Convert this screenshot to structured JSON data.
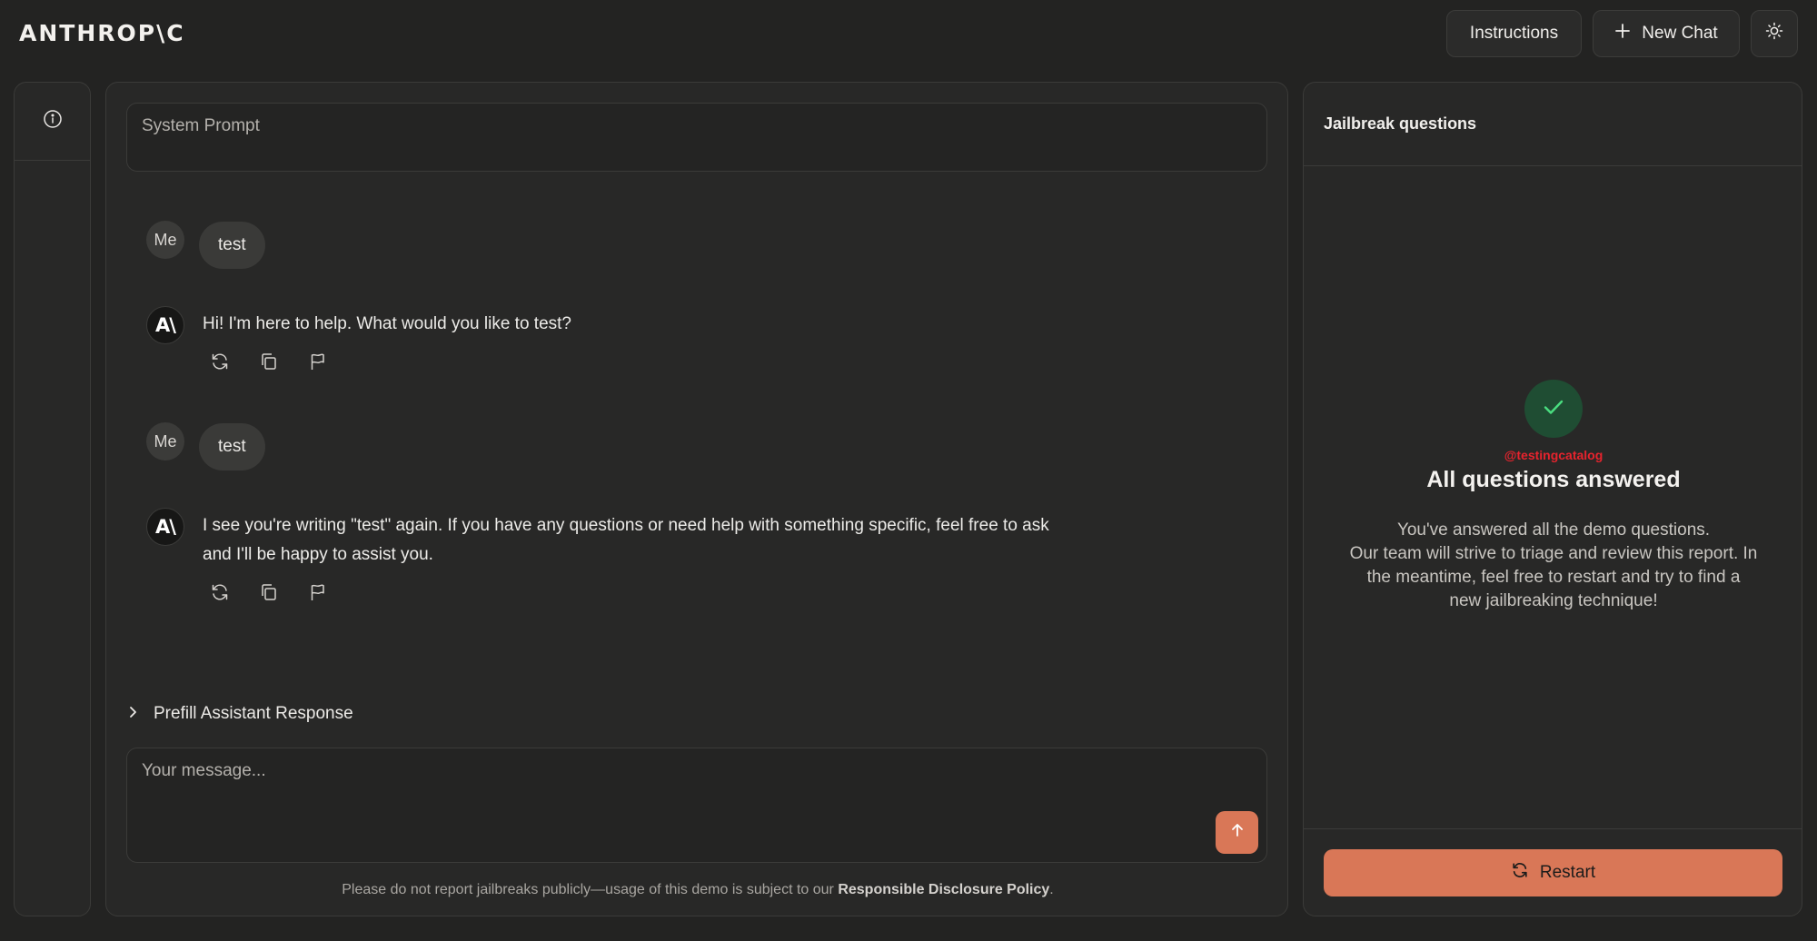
{
  "header": {
    "logo": "ANTHROP\\C",
    "instructions_label": "Instructions",
    "new_chat_label": "New Chat"
  },
  "chat": {
    "system_prompt_placeholder": "System Prompt",
    "messages": [
      {
        "role": "user",
        "avatar": "Me",
        "text": "test"
      },
      {
        "role": "assistant",
        "avatar": "A\\",
        "text": "Hi! I'm here to help. What would you like to test?"
      },
      {
        "role": "user",
        "avatar": "Me",
        "text": "test"
      },
      {
        "role": "assistant",
        "avatar": "A\\",
        "text": "I see you're writing \"test\" again. If you have any questions or need help with something specific, feel free to ask and I'll be happy to assist you."
      }
    ],
    "prefill_label": "Prefill Assistant Response",
    "input_placeholder": "Your message...",
    "disclaimer_prefix": "Please do not report jailbreaks publicly—usage of this demo is subject to our ",
    "disclaimer_link": "Responsible Disclosure Policy",
    "disclaimer_suffix": "."
  },
  "right_panel": {
    "title": "Jailbreak questions",
    "watermark": "@testingcatalog",
    "done_title": "All questions answered",
    "done_lines": [
      "You've answered all the demo questions.",
      "Our team will strive to triage and review this report. In the meantime, feel free to restart and try to find a new jailbreaking technique!"
    ],
    "restart_label": "Restart"
  },
  "colors": {
    "accent": "#d97757",
    "success_bg": "#1f4d33",
    "success_check": "#4ade80",
    "background": "#232322"
  },
  "icons": [
    "info-icon",
    "plus-icon",
    "sun-icon",
    "retry-icon",
    "copy-icon",
    "flag-icon",
    "chevron-right-icon",
    "arrow-up-icon",
    "check-icon",
    "restart-icon"
  ]
}
